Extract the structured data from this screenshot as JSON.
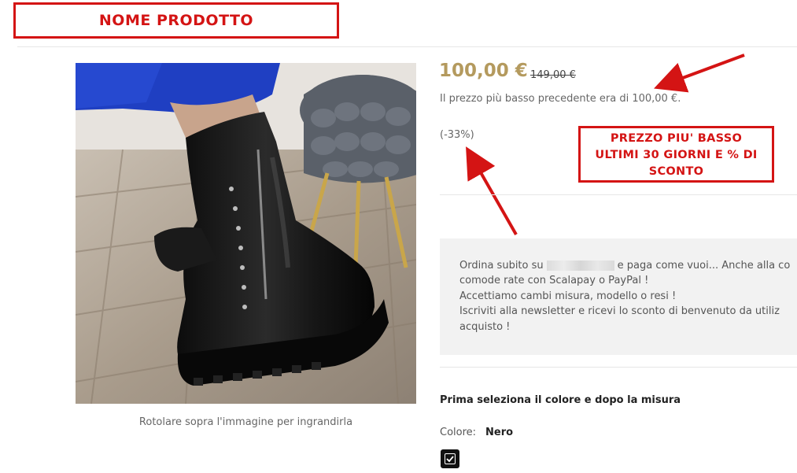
{
  "annotations": {
    "name_box": "NOME PRODOTTO",
    "price_box_lines": [
      "PREZZO PIU' BASSO",
      "ULTIMI 30 GIORNI E % DI",
      "SCONTO"
    ]
  },
  "product": {
    "price": "100,00 €",
    "old_price": "149,00 €",
    "lowest_price_note": "Il prezzo più basso precedente era di 100,00 €.",
    "discount": "(-33%)",
    "image_hint": "Rotolare sopra l'immagine per ingrandirla"
  },
  "promo": {
    "line1_before": "Ordina subito su",
    "line1_after": "e paga come vuoi... Anche alla co",
    "line2": "comode rate con Scalapay o PayPal !",
    "line3": "Accettiamo cambi misura, modello o resi !",
    "line4": "Iscriviti alla newsletter e ricevi lo sconto di benvenuto da utiliz",
    "line5": "acquisto !"
  },
  "selection": {
    "title": "Prima seleziona il colore e dopo la misura",
    "color_label": "Colore:",
    "color_value": "Nero"
  },
  "colors": {
    "annotation_red": "#d41414",
    "price_gold": "#b49a5e",
    "panel_bg": "#f2f2f2"
  }
}
